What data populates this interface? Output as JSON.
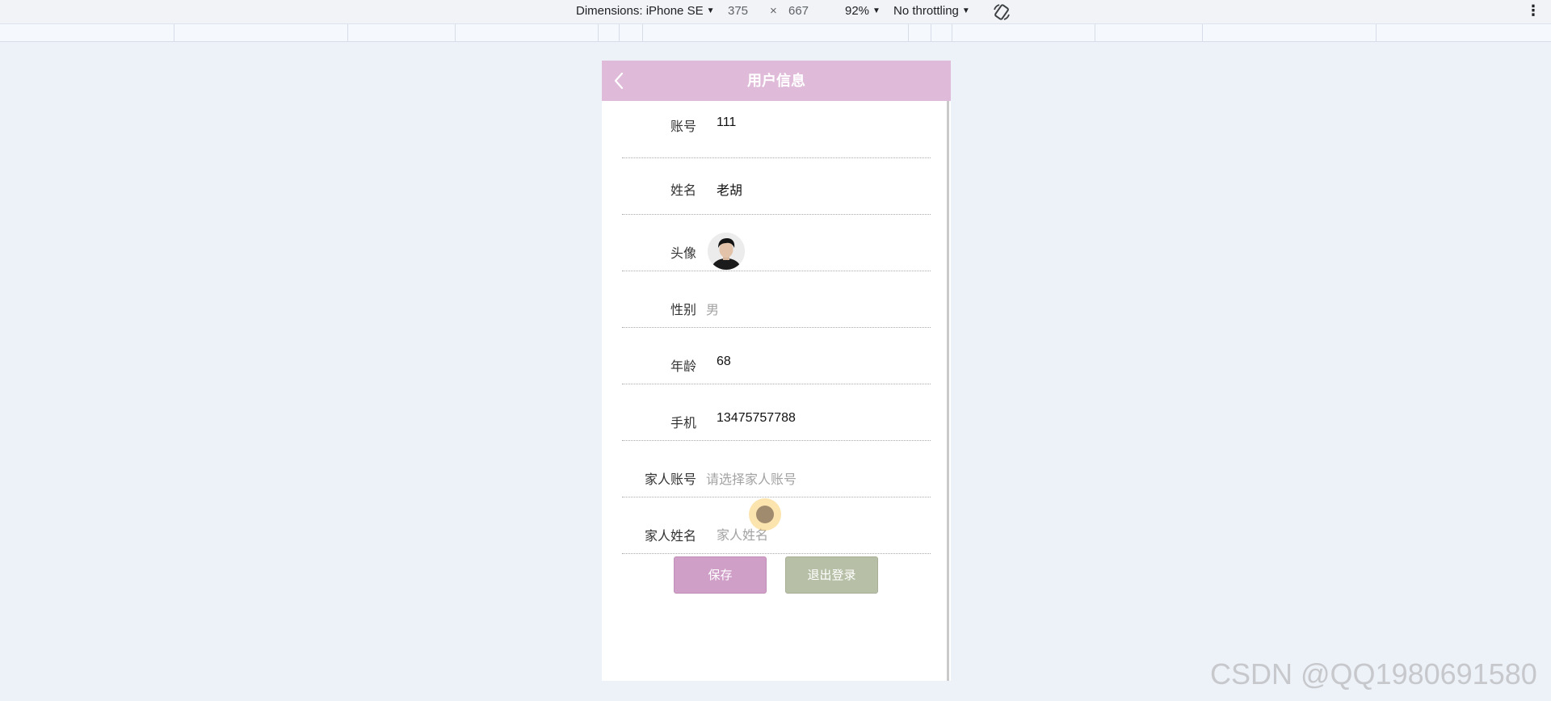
{
  "devtools": {
    "dimensions_label": "Dimensions: iPhone SE",
    "width_value": "375",
    "times_sign": "×",
    "height_value": "667",
    "zoom_label": "92%",
    "throttling_label": "No throttling",
    "rotate_icon": "rotate-device-icon",
    "more_icon": "more-vertical-icon"
  },
  "app": {
    "title": "用户信息",
    "back_icon": "chevron-left-icon",
    "header_color": "#dfbbd9"
  },
  "form": {
    "account": {
      "label": "账号",
      "value": "111"
    },
    "name": {
      "label": "姓名",
      "value": "老胡"
    },
    "avatar": {
      "label": "头像"
    },
    "gender": {
      "label": "性别",
      "value": "男"
    },
    "age": {
      "label": "年龄",
      "value": "68"
    },
    "phone": {
      "label": "手机",
      "value": "13475757788"
    },
    "family_account": {
      "label": "家人账号",
      "placeholder": "请选择家人账号"
    },
    "family_name": {
      "label": "家人姓名",
      "placeholder": "家人姓名"
    }
  },
  "buttons": {
    "save_label": "保存",
    "logout_label": "退出登录",
    "save_color": "#cf9fc8",
    "logout_color": "#b7c0a7"
  },
  "watermark": "CSDN @QQ1980691580"
}
